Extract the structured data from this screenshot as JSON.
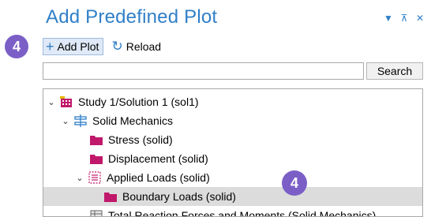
{
  "window": {
    "title": "Add Predefined Plot",
    "controls": [
      "dropdown-icon",
      "pin-icon",
      "close-icon"
    ]
  },
  "toolbar": {
    "add_plot_label": "Add Plot",
    "reload_label": "Reload"
  },
  "badges": {
    "first": "4",
    "second": "4"
  },
  "search": {
    "value": "",
    "placeholder": "",
    "button_label": "Search"
  },
  "tree": {
    "items": [
      {
        "label": "Study 1/Solution 1 (sol1)",
        "icon": "study-solution-icon",
        "expanded": true
      },
      {
        "label": "Solid Mechanics",
        "icon": "solid-mechanics-icon",
        "expanded": true
      },
      {
        "label": "Stress (solid)",
        "icon": "plot-group-icon"
      },
      {
        "label": "Displacement (solid)",
        "icon": "plot-group-icon"
      },
      {
        "label": "Applied Loads (solid)",
        "icon": "applied-loads-icon",
        "expanded": true
      },
      {
        "label": "Boundary Loads (solid)",
        "icon": "plot-group-icon",
        "selected": true
      },
      {
        "label": "Total Reaction Forces and Moments (Solid Mechanics)",
        "icon": "table-icon"
      }
    ]
  },
  "colors": {
    "accent": "#2f7fc8",
    "badge": "#7b5fc7",
    "plot_icon": "#c0186a",
    "selection": "#dcdcdc"
  }
}
